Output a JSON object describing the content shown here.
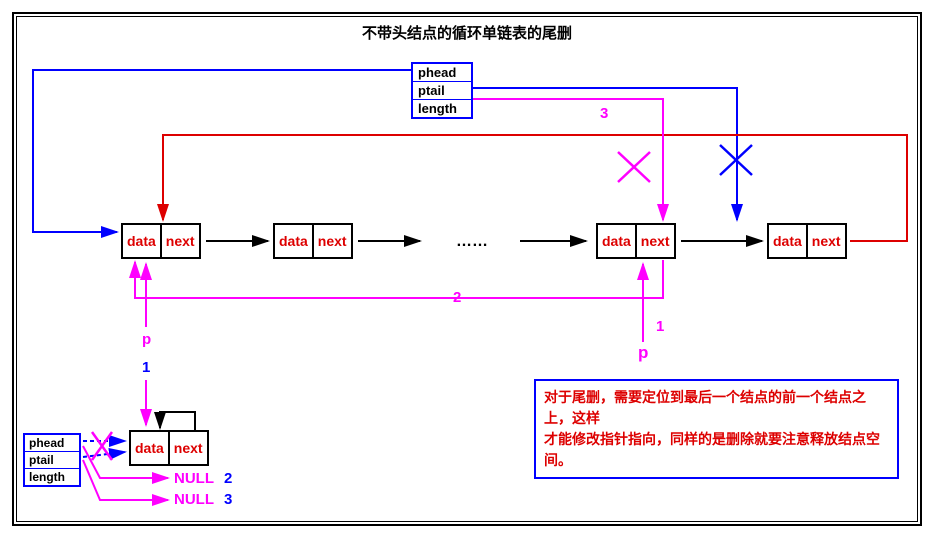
{
  "title": "不带头结点的循环单链表的尾删",
  "struct": {
    "a": "phead",
    "b": "ptail",
    "c": "length"
  },
  "node": {
    "data": "data",
    "next": "next"
  },
  "dots": "……",
  "labels": {
    "p1": "p",
    "p2": "p",
    "one_blue": "1",
    "one_mag": "1",
    "two_mag": "2",
    "two_blue": "2",
    "three_mag": "3",
    "three_blue": "3",
    "null1": "NULL",
    "null2": "NULL"
  },
  "note": {
    "line1": "对于尾删，需要定位到最后一个结点的前一个结点之上，这样",
    "line2": "才能修改指针指向，同样的是删除就要注意释放结点空间。"
  },
  "colors": {
    "blue": "#0000ff",
    "red": "#dd0000",
    "magenta": "#ff00ff",
    "black": "#000000"
  }
}
